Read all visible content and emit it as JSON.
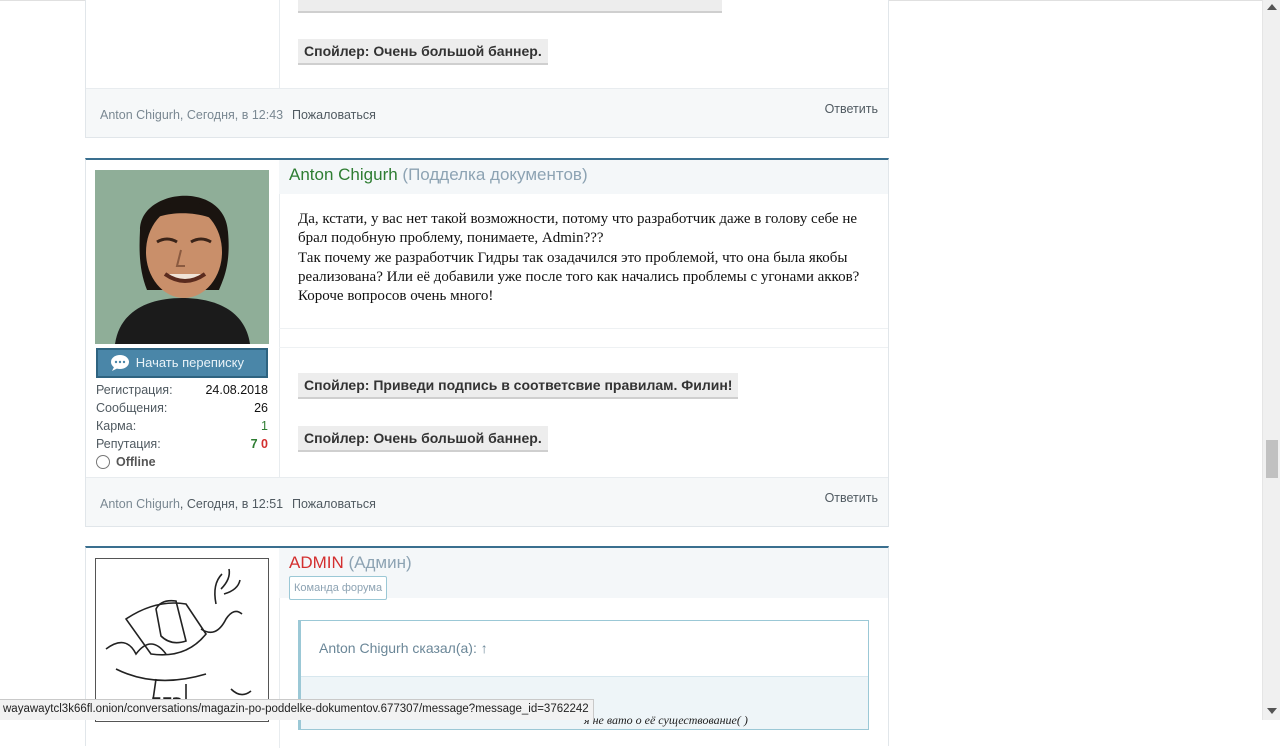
{
  "posts": [
    {
      "footer": {
        "author": "Anton Chigurh",
        "time": ", Сегодня, в 12:43",
        "report": "Пожаловаться",
        "reply": "Ответить"
      },
      "spoilers": [
        "Спойлер: Очень большой баннер."
      ]
    },
    {
      "username": "Anton Chigurh",
      "user_title": "(Подделка документов)",
      "button": "Начать переписку",
      "stats": {
        "registration_label": "Регистрация:",
        "registration": "24.08.2018",
        "messages_label": "Сообщения:",
        "messages": "26",
        "karma_label": "Карма:",
        "karma": "1",
        "reputation_label": "Репутация:",
        "rep_pos": "7",
        "rep_neg": "0",
        "status": "Offline"
      },
      "message": [
        "Да, кстати, у вас нет такой возможности, потому что разработчик даже в голову себе не",
        "брал подобную проблему, понимаете, Admin???",
        "Так почему же разработчик Гидры так озадачился это проблемой, что она была якобы",
        "реализована? Или её добавили уже после того как начались проблемы с угонами акков?",
        "Короче вопросов очень много!"
      ],
      "spoilers": [
        "Спойлер: Приведи подпись в соответсвие правилам. Филин!",
        "Спойлер: Очень большой баннер."
      ],
      "footer": {
        "author": "Anton Chigurh",
        "time": ", Сегодня, в 12:51",
        "report": "Пожаловаться",
        "reply": "Ответить"
      }
    },
    {
      "username": "ADMIN",
      "user_title": "(Админ)",
      "badge": "Команда форума",
      "quote_header": "Anton Chigurh сказал(а): ↑",
      "quote_text_partial": "я не вато о её существование( )"
    }
  ],
  "status_bar": {
    "url": "wayawaytcl3k66fl.onion/conversations/magazin-po-poddelke-dokumentov.677307/message?message_id=3762242"
  },
  "icons": {
    "chat": "chat-bubble-icon",
    "offline": "offline-circle-icon"
  },
  "colors": {
    "accent": "#3a6f8f",
    "username_green": "#2e7d32",
    "username_red": "#d32f2f",
    "button": "#4a86a8"
  }
}
